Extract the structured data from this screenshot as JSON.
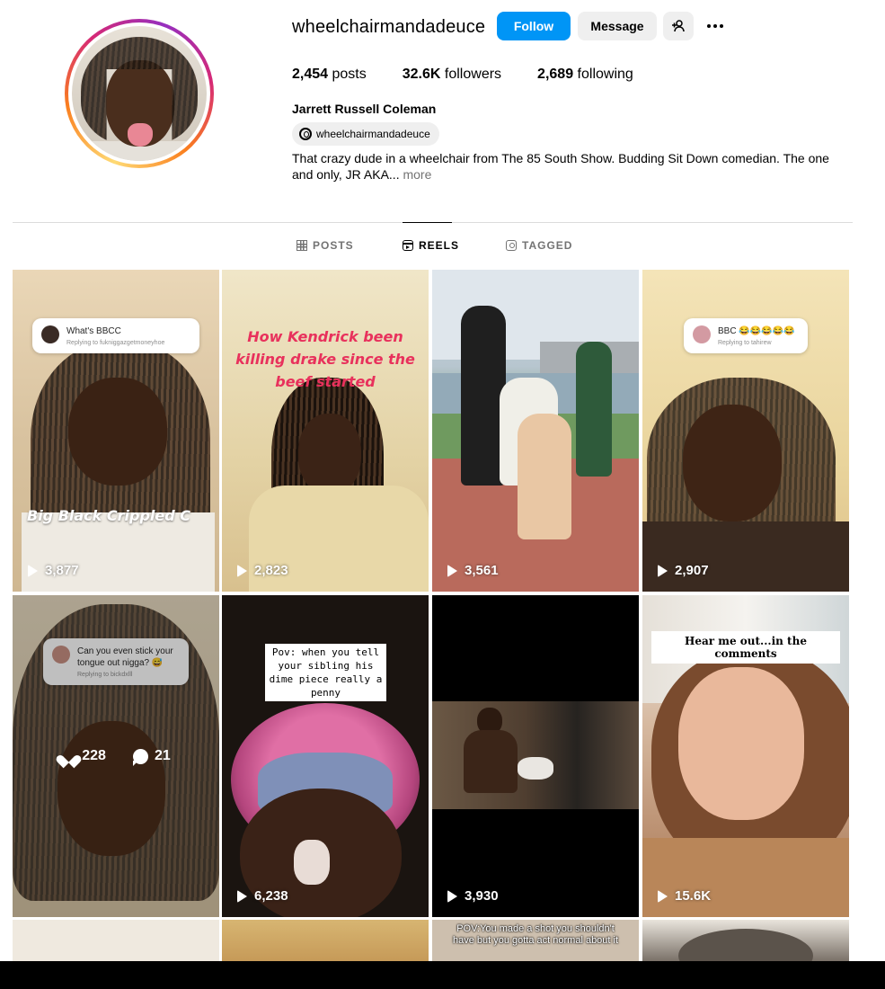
{
  "profile": {
    "username": "wheelchairmandadeuce",
    "follow_label": "Follow",
    "message_label": "Message",
    "stats": [
      {
        "value": "2,454",
        "label": "posts"
      },
      {
        "value": "32.6K",
        "label": "followers"
      },
      {
        "value": "2,689",
        "label": "following"
      }
    ],
    "full_name": "Jarrett Russell Coleman",
    "threads_handle": "wheelchairmandadeuce",
    "bio": "That crazy dude in a wheelchair from The 85 South Show. Budding Sit Down comedian. The one and only, JR AKA...",
    "bio_more": "more"
  },
  "tabs": [
    {
      "label": "POSTS",
      "icon": "grid-icon"
    },
    {
      "label": "REELS",
      "icon": "reels-icon"
    },
    {
      "label": "TAGGED",
      "icon": "tagged-icon"
    }
  ],
  "reels": [
    {
      "views": "3,877",
      "comment": "What's BBCC",
      "reply": "Replying to fukniggazgetmoneyhoe",
      "caption": "Big Black Crippled C"
    },
    {
      "views": "2,823",
      "caption": "How Kendrick been killing drake since the beef started"
    },
    {
      "views": "3,561"
    },
    {
      "views": "2,907",
      "comment": "BBC 😂😂😂😂😂",
      "reply": "Replying to tahirew"
    },
    {
      "likes": "228",
      "comments": "21",
      "comment": "Can you even stick your tongue out nigga? 😅",
      "reply": "Replying to bickdxlll"
    },
    {
      "views": "6,238",
      "caption": "Pov: when you tell your sibling his dime piece really a penny"
    },
    {
      "views": "3,930"
    },
    {
      "views": "15.6K",
      "caption": "Hear me out...in the comments"
    },
    {},
    {},
    {
      "caption": "POV:You made a shot you shouldn't have but you gotta act normal about it"
    },
    {}
  ],
  "colors": {
    "follow_button": "#0095f6",
    "secondary_button": "#efefef",
    "muted_text": "#737373",
    "divider": "#dbdbdb"
  }
}
